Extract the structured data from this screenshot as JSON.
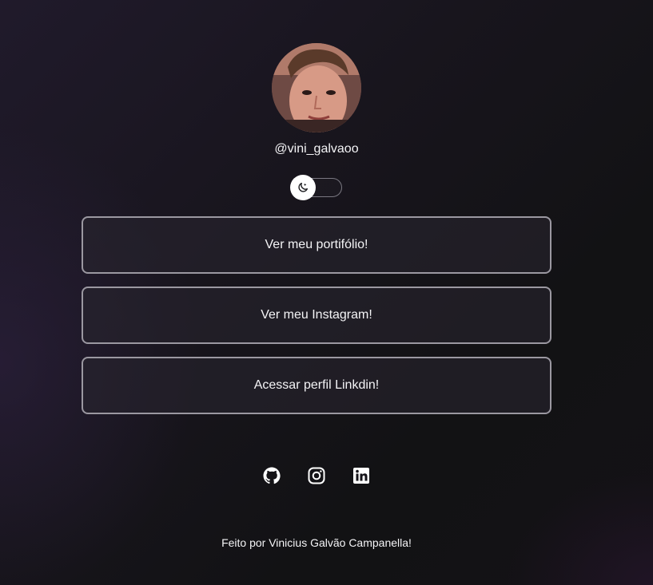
{
  "profile": {
    "username": "@vini_galvaoo",
    "avatar_icon": "profile-photo"
  },
  "theme_toggle": {
    "icon": "moon-icon",
    "state": "dark"
  },
  "links": [
    {
      "label": "Ver meu portifólio!"
    },
    {
      "label": "Ver meu Instagram!"
    },
    {
      "label": "Acessar perfil Linkdin!"
    }
  ],
  "socials": [
    {
      "icon": "github-icon"
    },
    {
      "icon": "instagram-icon"
    },
    {
      "icon": "linkedin-icon"
    }
  ],
  "footer": {
    "text": "Feito por Vinicius Galvão Campanella!"
  },
  "colors": {
    "background": "#121214",
    "button_border": "#9b98a1",
    "text": "#f4f4f6"
  }
}
